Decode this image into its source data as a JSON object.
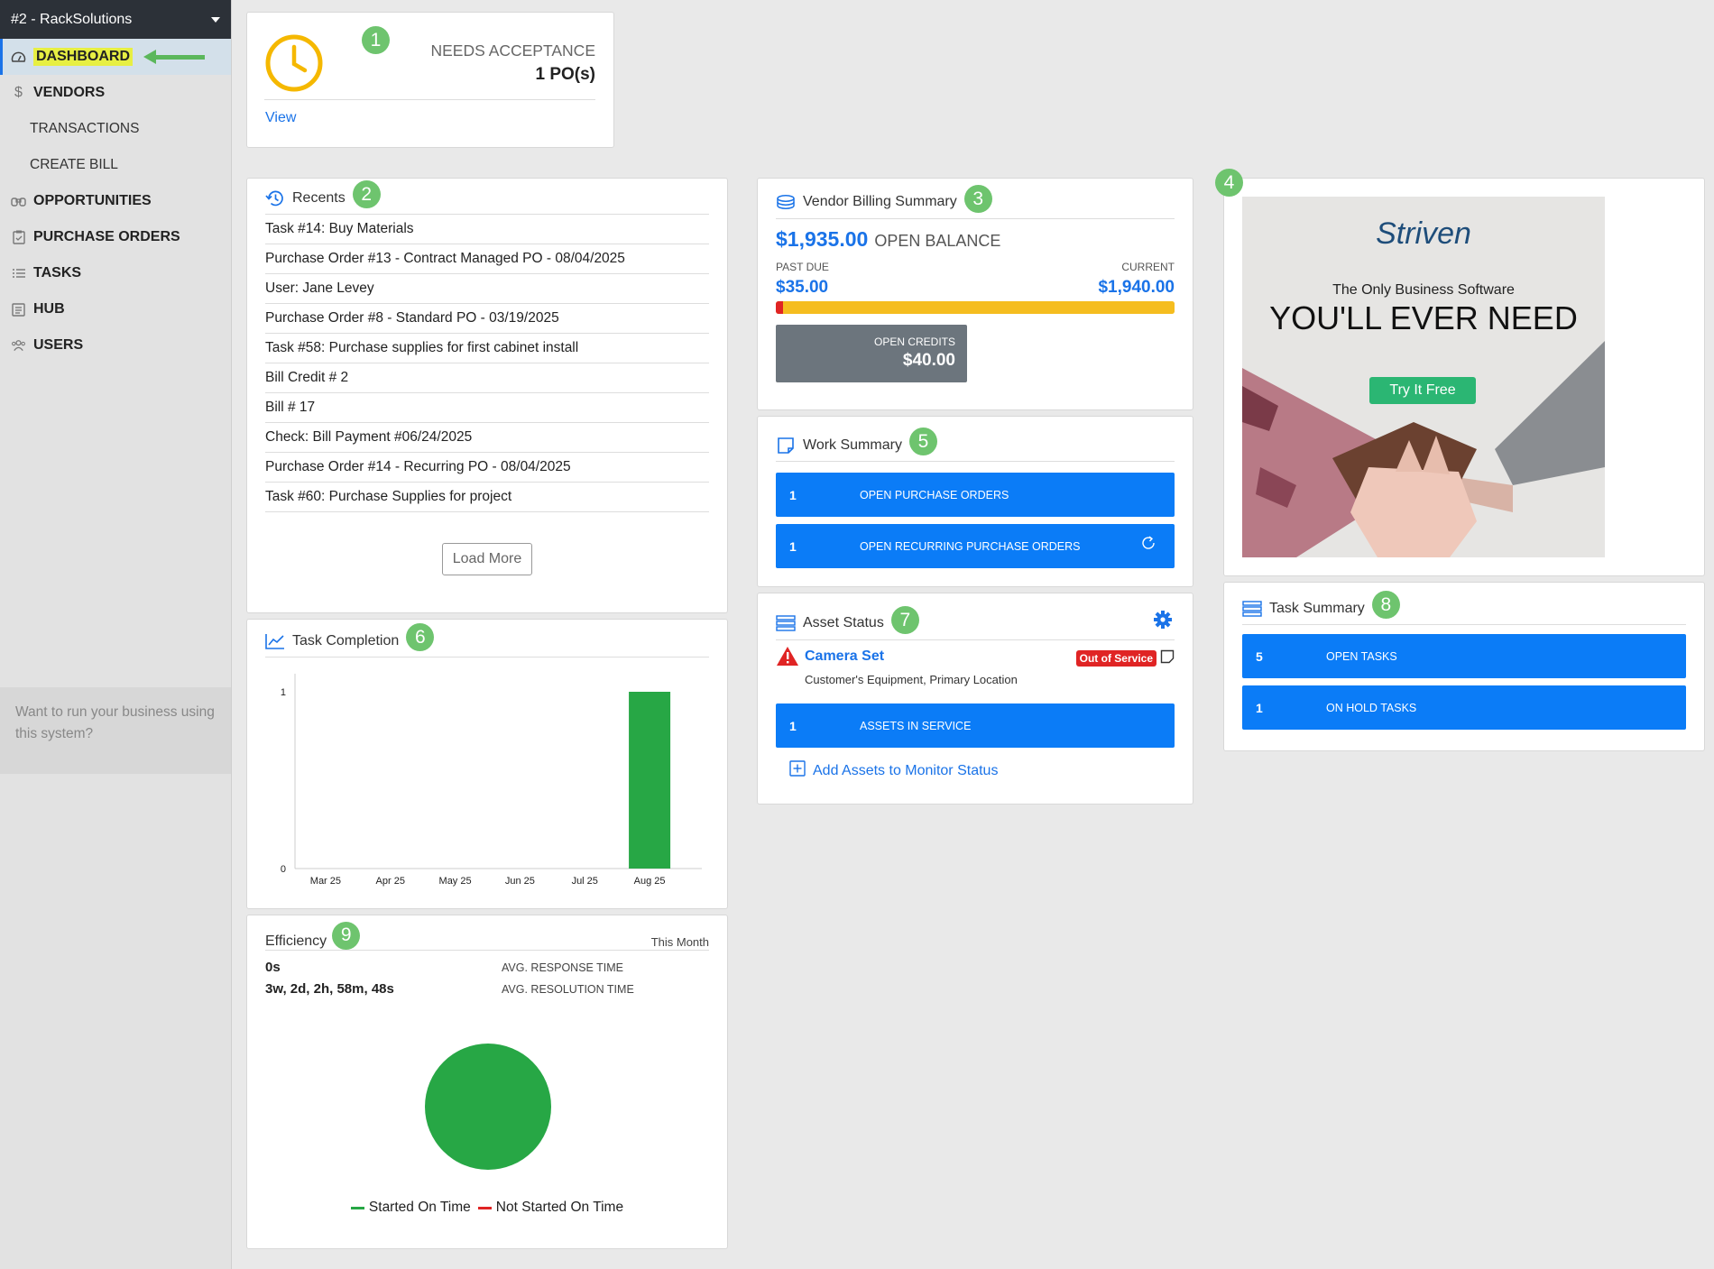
{
  "sidebar": {
    "company": "#2 - RackSolutions",
    "items": [
      {
        "label": "DASHBOARD"
      },
      {
        "label": "VENDORS"
      },
      {
        "label": "TRANSACTIONS"
      },
      {
        "label": "CREATE BILL"
      },
      {
        "label": "OPPORTUNITIES"
      },
      {
        "label": "PURCHASE ORDERS"
      },
      {
        "label": "TASKS"
      },
      {
        "label": "HUB"
      },
      {
        "label": "USERS"
      }
    ],
    "promo": "Want to run your business using this system?"
  },
  "badges": [
    "1",
    "2",
    "3",
    "4",
    "5",
    "6",
    "7",
    "8",
    "9"
  ],
  "needs_acceptance": {
    "title": "NEEDS ACCEPTANCE",
    "count": "1 PO(s)",
    "link": "View"
  },
  "recents": {
    "title": "Recents",
    "items": [
      "Task #14: Buy Materials",
      "Purchase Order #13 - Contract Managed PO - 08/04/2025",
      "User: Jane Levey",
      "Purchase Order #8 - Standard PO - 03/19/2025",
      "Task #58: Purchase supplies for first cabinet install",
      "Bill Credit # 2",
      "Bill # 17",
      "Check: Bill Payment #06/24/2025",
      "Purchase Order #14 - Recurring PO - 08/04/2025",
      "Task #60: Purchase Supplies for project"
    ],
    "load_more": "Load More"
  },
  "billing": {
    "title": "Vendor Billing Summary",
    "open_balance_amount": "$1,935.00",
    "open_balance_label": "OPEN BALANCE",
    "past_due_label": "PAST DUE",
    "past_due": "$35.00",
    "current_label": "CURRENT",
    "current": "$1,940.00",
    "past_due_fraction": 0.018,
    "credits_label": "OPEN CREDITS",
    "credits": "$40.00",
    "colors": {
      "past_due": "#e02424",
      "current": "#f5bd1f"
    }
  },
  "ad": {
    "brand": "Striven",
    "tagline": "The Only Business Software",
    "headline": "YOU'LL EVER NEED",
    "cta": "Try It Free"
  },
  "work_summary": {
    "title": "Work Summary",
    "rows": [
      {
        "count": "1",
        "label": "OPEN PURCHASE ORDERS"
      },
      {
        "count": "1",
        "label": "OPEN RECURRING PURCHASE ORDERS"
      }
    ]
  },
  "task_completion": {
    "title": "Task Completion"
  },
  "chart_data": {
    "type": "bar",
    "categories": [
      "Mar 25",
      "Apr 25",
      "May 25",
      "Jun 25",
      "Jul 25",
      "Aug 25"
    ],
    "values": [
      0,
      0,
      0,
      0,
      0,
      1
    ],
    "ylim": [
      0,
      1
    ],
    "yticks": [
      "0",
      "1"
    ],
    "color": "#27a745"
  },
  "asset_status": {
    "title": "Asset Status",
    "asset_name": "Camera Set",
    "asset_desc": "Customer's Equipment, Primary Location",
    "status": "Out of Service",
    "row": {
      "count": "1",
      "label": "ASSETS IN SERVICE"
    },
    "add_link": "Add Assets to Monitor Status"
  },
  "task_summary": {
    "title": "Task Summary",
    "rows": [
      {
        "count": "5",
        "label": "OPEN TASKS"
      },
      {
        "count": "1",
        "label": "ON HOLD TASKS"
      }
    ]
  },
  "efficiency": {
    "title": "Efficiency",
    "period": "This Month",
    "response_value": "0s",
    "response_label": "AVG. RESPONSE TIME",
    "resolution_value": "3w, 2d, 2h, 58m, 48s",
    "resolution_label": "AVG. RESOLUTION TIME",
    "legend": [
      {
        "label": "Started On Time",
        "color": "#27a745"
      },
      {
        "label": "Not Started On Time",
        "color": "#e02424"
      }
    ],
    "pie": [
      {
        "label": "Started On Time",
        "fraction": 1.0
      }
    ]
  }
}
